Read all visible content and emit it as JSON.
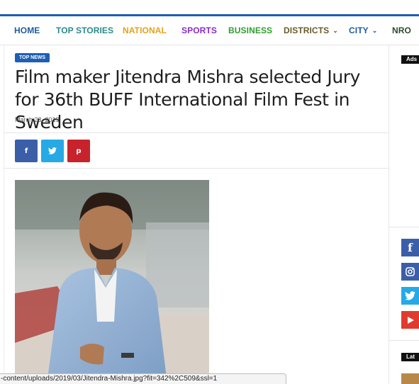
{
  "nav": {
    "items": [
      {
        "label": "HOME",
        "color": "#1f5c9e"
      },
      {
        "label": "TOP STORIES",
        "color": "#2a8a8a"
      },
      {
        "label": "NATIONAL",
        "color": "#e3a21a"
      },
      {
        "label": "SPORTS",
        "color": "#8a2cc4"
      },
      {
        "label": "BUSINESS",
        "color": "#2e9d2e"
      },
      {
        "label": "DISTRICTS",
        "color": "#6a5a2a",
        "dropdown": true
      },
      {
        "label": "CITY",
        "color": "#1f5c9e",
        "dropdown": true
      },
      {
        "label": "NRO",
        "color": "#2b4a2b"
      }
    ],
    "accent": "#1d5fb4"
  },
  "article": {
    "category": "TOP NEWS",
    "title": "Film maker Jitendra Mishra selected Jury for 36th BUFF International Film Fest in Sweden",
    "date": "March 23, 2019",
    "share": [
      {
        "icon": "facebook-icon",
        "glyph": "f"
      },
      {
        "icon": "twitter-icon",
        "glyph": "🐦"
      },
      {
        "icon": "pinterest-icon",
        "glyph": "p"
      }
    ]
  },
  "sidebar": {
    "ads_label": "Ads",
    "latest_label": "Lat",
    "social": [
      {
        "icon": "facebook-icon",
        "glyph": "f"
      },
      {
        "icon": "instagram-icon",
        "glyph": "◎"
      },
      {
        "icon": "twitter-icon",
        "glyph": "🐦"
      },
      {
        "icon": "youtube-icon",
        "glyph": "▶"
      }
    ]
  },
  "status_bar": {
    "url": "-content/uploads/2019/03/Jitendra-Mishra.jpg?fit=342%2C509&ssl=1"
  }
}
